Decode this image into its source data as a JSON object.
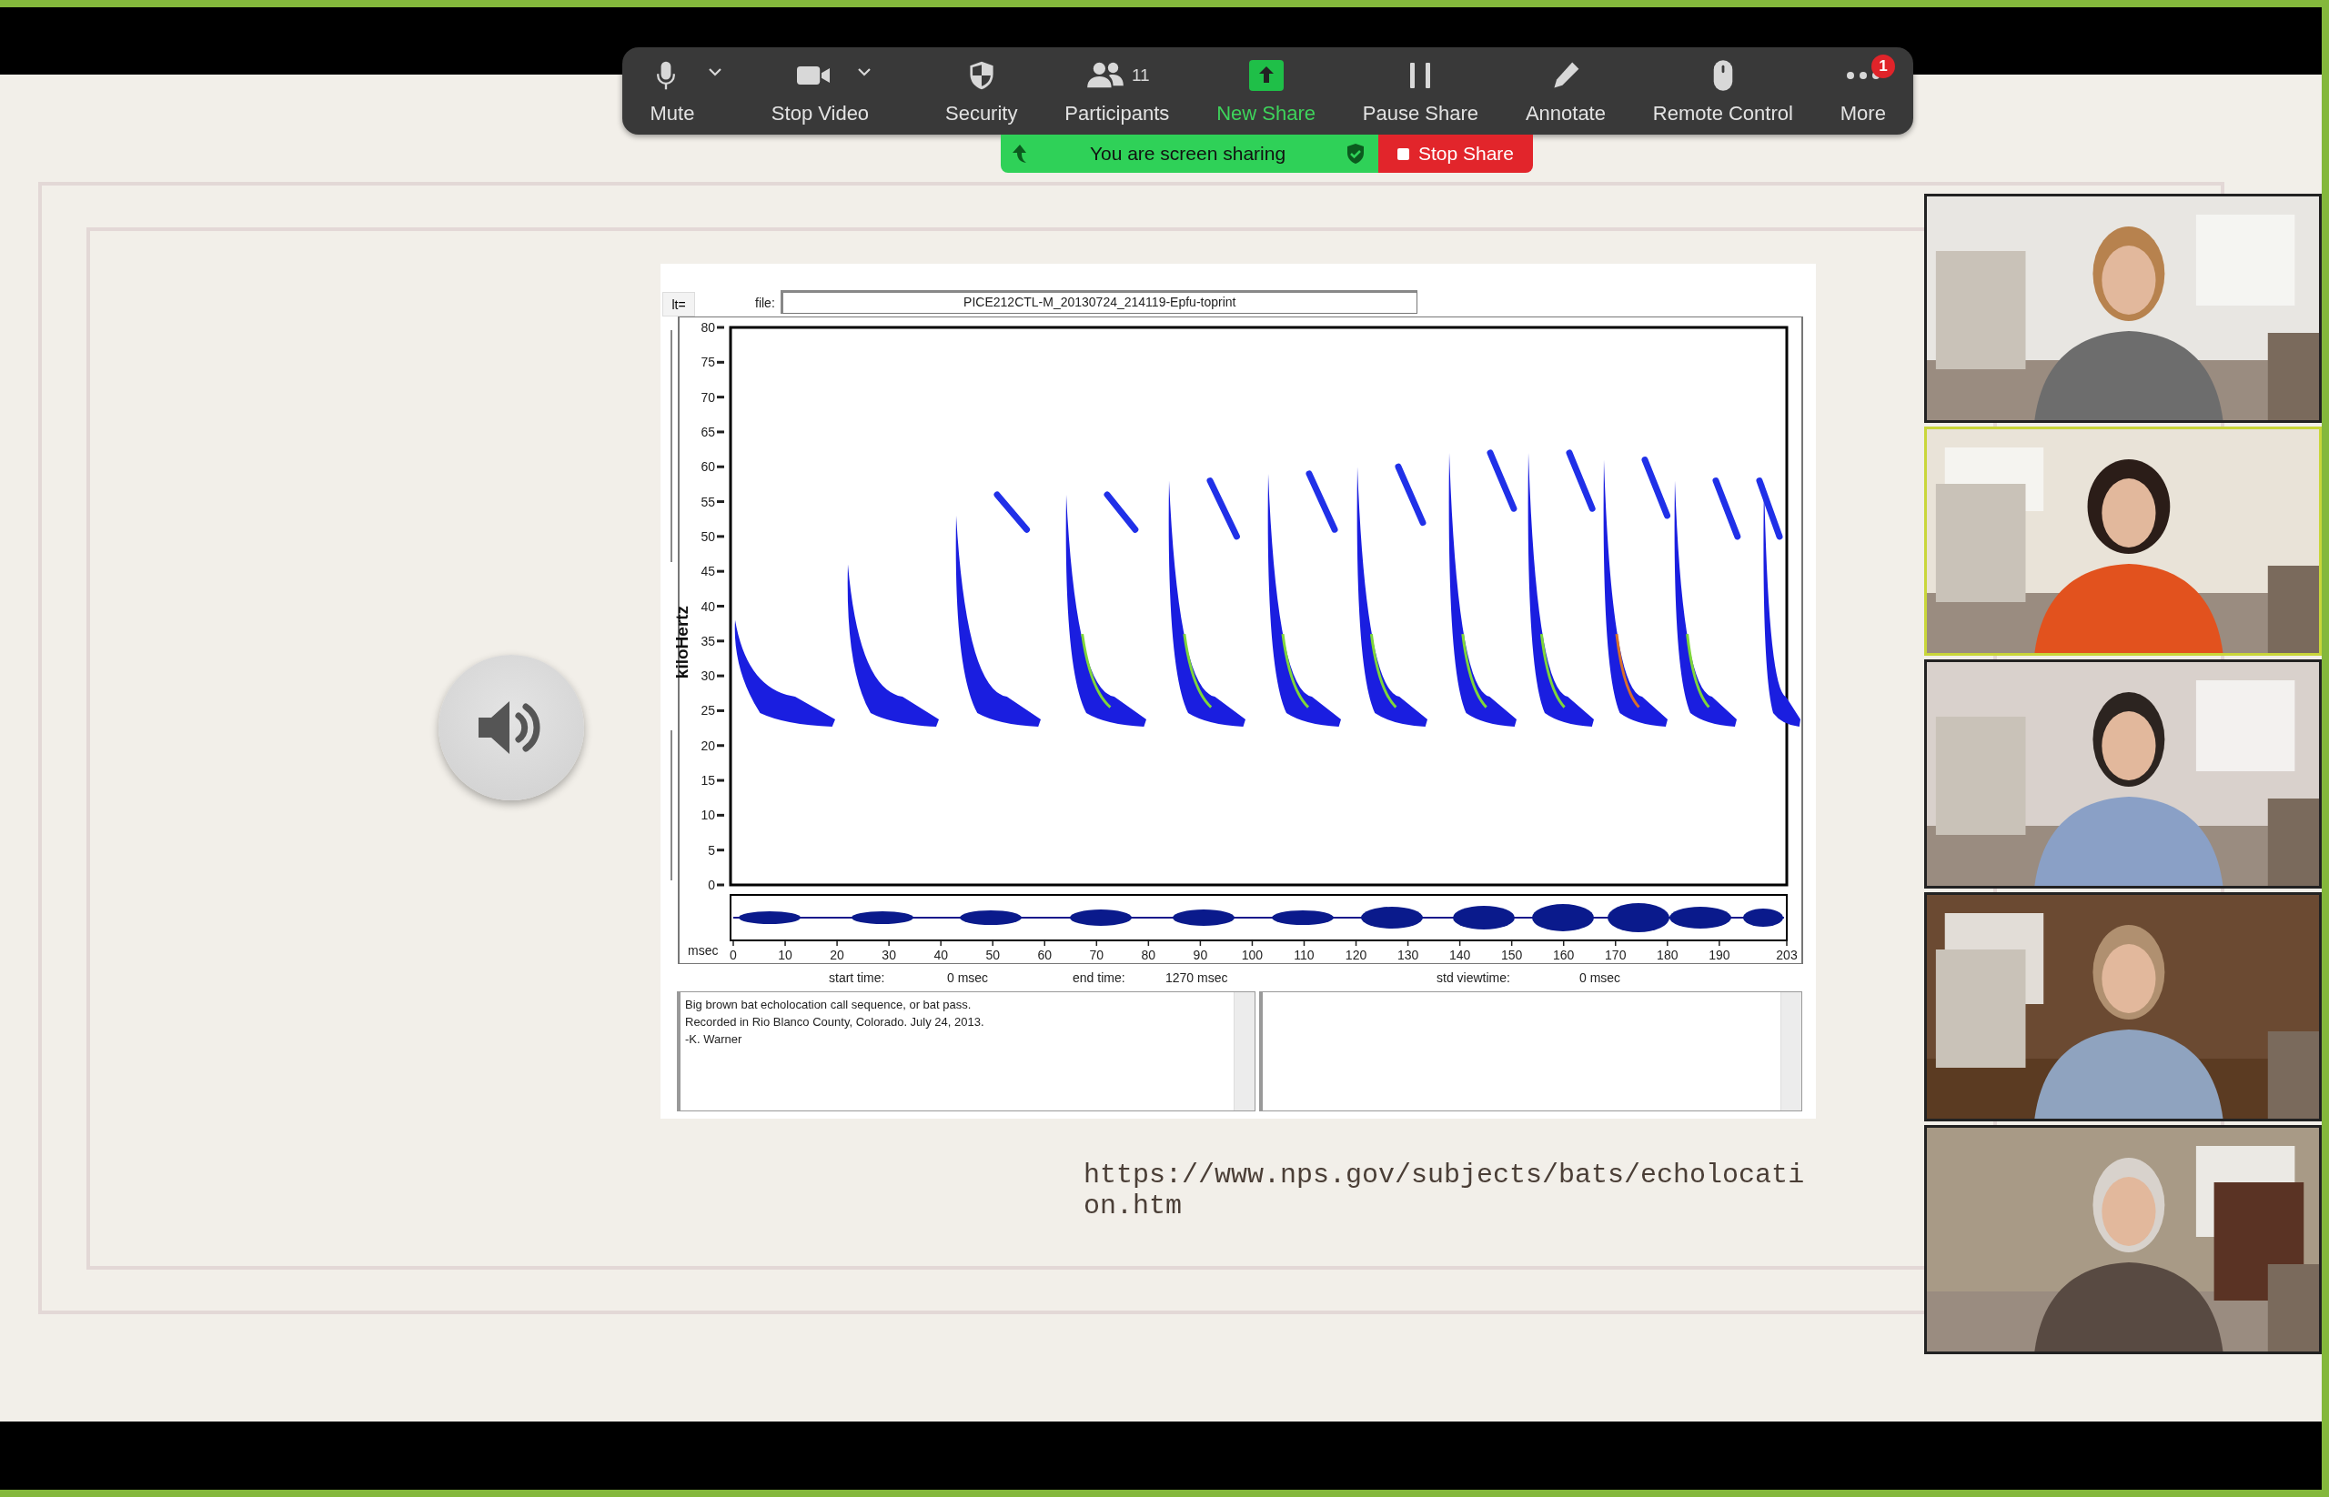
{
  "toolbar": {
    "items": [
      {
        "kind": "mic",
        "label": "Mute",
        "has_menu": true,
        "active": false
      },
      {
        "kind": "video",
        "label": "Stop Video",
        "has_menu": true,
        "active": false
      },
      {
        "kind": "security",
        "label": "Security",
        "has_menu": false,
        "active": false
      },
      {
        "kind": "participants",
        "label": "Participants",
        "count": "11",
        "has_menu": false,
        "active": false
      },
      {
        "kind": "share",
        "label": "New Share",
        "has_menu": false,
        "active": true
      },
      {
        "kind": "pause",
        "label": "Pause Share",
        "has_menu": false,
        "active": false
      },
      {
        "kind": "annotate",
        "label": "Annotate",
        "has_menu": false,
        "active": false
      },
      {
        "kind": "remote",
        "label": "Remote Control",
        "has_menu": false,
        "active": false
      },
      {
        "kind": "more",
        "label": "More",
        "badge": "1",
        "has_menu": false,
        "active": false
      }
    ]
  },
  "share_bar": {
    "status": "You are screen sharing",
    "stop_button": "Stop Share"
  },
  "slide": {
    "spectrogram": {
      "lt_button": "lt=",
      "file_label": "file:",
      "file_name": "PICE212CTL-M_20130724_214119-Epfu-toprint",
      "y_label": "kiloHertz",
      "y_ticks": [
        "80",
        "75",
        "70",
        "65",
        "60",
        "55",
        "50",
        "45",
        "40",
        "35",
        "30",
        "25",
        "20",
        "15",
        "10",
        "5",
        "0"
      ],
      "x_unit": "msec",
      "x_ticks": [
        "0",
        "10",
        "20",
        "30",
        "40",
        "50",
        "60",
        "70",
        "80",
        "90",
        "100",
        "110",
        "120",
        "130",
        "140",
        "150",
        "160",
        "170",
        "180",
        "190",
        "203"
      ],
      "start_time_label": "start time:",
      "start_time_value": "0 msec",
      "end_time_label": "end time:",
      "end_time_value": "1270 msec",
      "std_viewtime_label": "std viewtime:",
      "std_viewtime_value": "0 msec",
      "notes": [
        "Big brown bat echolocation call sequence, or bat pass.",
        "Recorded in Rio Blanco County, Colorado. July 24, 2013.",
        "-K. Warner"
      ]
    },
    "link": "https://www.nps.gov/subjects/bats/echolocation.htm"
  },
  "video_tiles": [
    {
      "kind": "picture",
      "speaking": false
    },
    {
      "kind": "picture",
      "speaking": true
    },
    {
      "kind": "picture",
      "speaking": false
    },
    {
      "kind": "picture",
      "speaking": false
    },
    {
      "kind": "picture",
      "speaking": false
    }
  ]
}
